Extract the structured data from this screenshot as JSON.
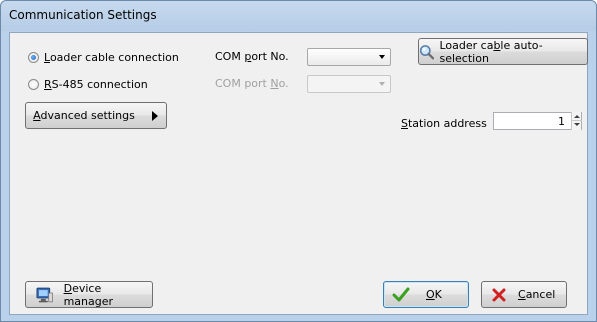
{
  "window": {
    "title": "Communication Settings"
  },
  "connection": {
    "loader_cable": {
      "label": "Loader cable connection",
      "checked": true
    },
    "rs485": {
      "label_prefix": "",
      "label_underlined": "R",
      "label_suffix": "S-485 connection",
      "checked": false
    }
  },
  "com_port": {
    "label_prefix": "COM ",
    "label_underlined": "p",
    "label_suffix": "ort No.",
    "value": ""
  },
  "com_port_disabled": {
    "label_prefix": "COM port ",
    "label_underlined": "N",
    "label_suffix": "o.",
    "value": ""
  },
  "buttons": {
    "auto_selection": {
      "prefix": "Loader ca",
      "underlined": "b",
      "suffix": "le auto-selection"
    },
    "advanced": {
      "prefix": "",
      "underlined": "A",
      "suffix": "dvanced settings"
    },
    "device_manager": {
      "prefix": "",
      "underlined": "D",
      "suffix": "evice manager"
    },
    "ok": {
      "prefix": "",
      "underlined": "O",
      "suffix": "K"
    },
    "cancel": {
      "prefix": "",
      "underlined": "C",
      "suffix": "ancel"
    }
  },
  "station": {
    "label_prefix": "",
    "label_underlined": "S",
    "label_suffix": "tation address",
    "value": "1"
  },
  "colors": {
    "ok_check": "#3aa020",
    "cancel_x": "#d02020"
  }
}
